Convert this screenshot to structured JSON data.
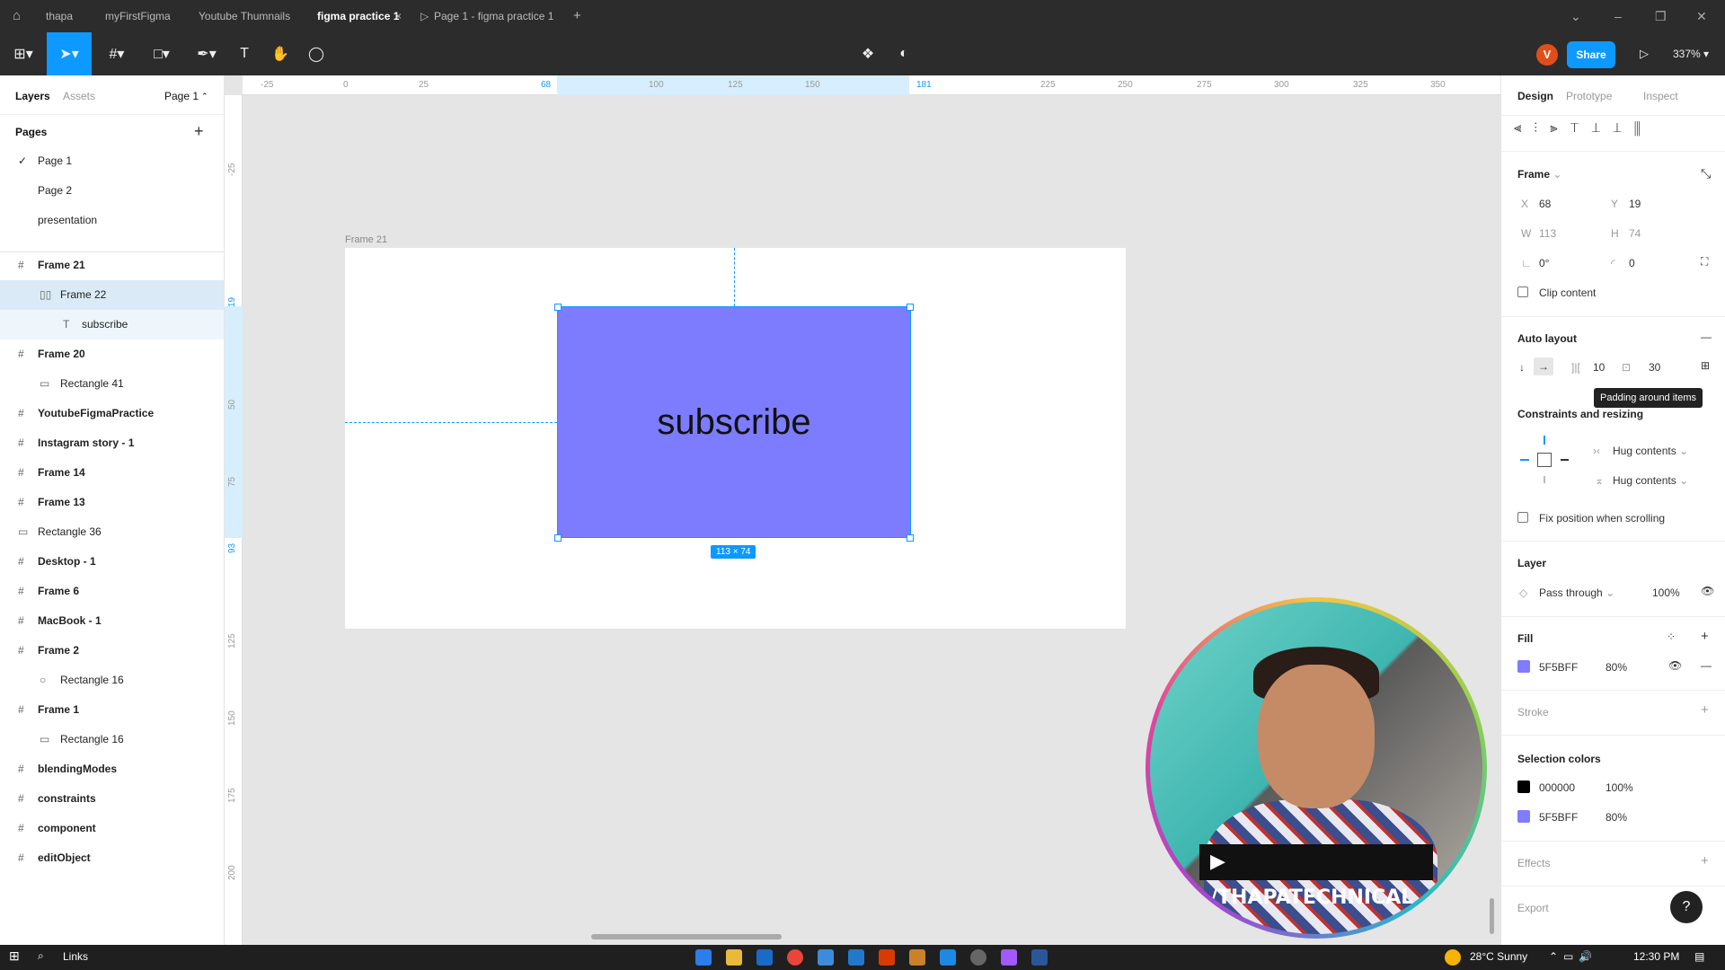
{
  "tabs": [
    "thapa",
    "myFirstFigma",
    "Youtube Thumnails",
    "figma practice 1",
    "Page 1 - figma practice 1"
  ],
  "toolbar": {
    "share": "Share",
    "zoom": "337%",
    "avatar_letter": "V"
  },
  "left_panel": {
    "tab_layers": "Layers",
    "tab_assets": "Assets",
    "page_selector": "Page 1",
    "pages_header": "Pages",
    "pages": [
      "Page 1",
      "Page 2",
      "presentation"
    ],
    "layers": [
      "Frame 21",
      "Frame 22",
      "subscribe",
      "Frame 20",
      "Rectangle 41",
      "YoutubeFigmaPractice",
      "Instagram story - 1",
      "Frame 14",
      "Frame 13",
      "Rectangle 36",
      "Desktop - 1",
      "Frame 6",
      "MacBook - 1",
      "Frame 2",
      "Rectangle 16",
      "Frame 1",
      "Rectangle 16",
      "blendingModes",
      "constraints",
      "component",
      "editObject"
    ]
  },
  "canvas": {
    "frame_label": "Frame 21",
    "button_text": "subscribe",
    "size_badge": "113 × 74",
    "ruler_top": [
      "-25",
      "0",
      "25",
      "68",
      "100",
      "125",
      "150",
      "181",
      "225",
      "250",
      "275",
      "300",
      "325",
      "350"
    ],
    "ruler_left": [
      "-25",
      "19",
      "50",
      "75",
      "93",
      "125",
      "150",
      "175",
      "200"
    ],
    "webcam_text": "/THAPATECHNICAL"
  },
  "right_panel": {
    "tab_design": "Design",
    "tab_prototype": "Prototype",
    "tab_inspect": "Inspect",
    "frame_header": "Frame",
    "x_label": "X",
    "x": "68",
    "y_label": "Y",
    "y": "19",
    "w_label": "W",
    "w": "113",
    "h_label": "H",
    "h": "74",
    "rotation": "0°",
    "radius": "0",
    "clip_content": "Clip content",
    "auto_layout": "Auto layout",
    "spacing": "10",
    "padding": "30",
    "tooltip": "Padding around items",
    "constraints": "Constraints and resizing",
    "hug1": "Hug contents",
    "hug2": "Hug contents",
    "fix_position": "Fix position when scrolling",
    "layer_header": "Layer",
    "blend": "Pass through",
    "layer_opacity": "100%",
    "fill_header": "Fill",
    "fill_hex": "5F5BFF",
    "fill_opacity": "80%",
    "stroke_header": "Stroke",
    "selection_colors": "Selection colors",
    "sel1_hex": "000000",
    "sel1_opacity": "100%",
    "sel2_hex": "5F5BFF",
    "sel2_opacity": "80%",
    "effects": "Effects",
    "export": "Export"
  },
  "taskbar": {
    "search": "Links",
    "weather": "28°C  Sunny",
    "time": "12:30 PM"
  },
  "colors": {
    "accent": "#0d99ff",
    "fill": "#5F5BFF",
    "frame_fill_display": "#7d7cff",
    "share": "#0d99ff"
  }
}
